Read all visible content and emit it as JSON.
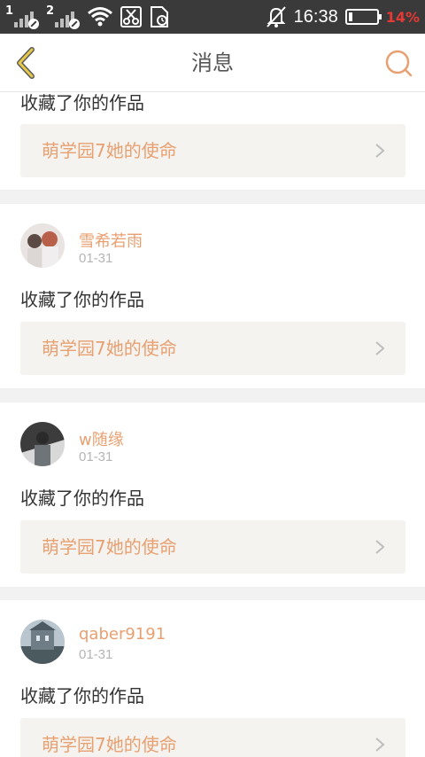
{
  "status_bar": {
    "sim1": "1",
    "sim2": "2",
    "time": "16:38",
    "battery_pct": "14%",
    "battery_level": 0.14,
    "icons": [
      "signal-icon",
      "wifi-icon",
      "scissors-icon",
      "sd-card-icon",
      "alarm-off-icon",
      "battery-icon"
    ]
  },
  "header": {
    "title": "消息",
    "back_icon": "chevron-left-icon",
    "search_icon": "search-icon",
    "accent": "#e8a071",
    "back_color": "#e6c84a"
  },
  "messages": [
    {
      "action": "收藏了你的作品",
      "work": "萌学园7她的使命"
    },
    {
      "user": "雪希若雨",
      "date": "01-31",
      "action": "收藏了你的作品",
      "work": "萌学园7她的使命"
    },
    {
      "user": "w随缘",
      "date": "01-31",
      "action": "收藏了你的作品",
      "work": "萌学园7她的使命"
    },
    {
      "user": "qaber9191",
      "date": "01-31",
      "action": "收藏了你的作品",
      "work": "萌学园7她的使命"
    }
  ]
}
